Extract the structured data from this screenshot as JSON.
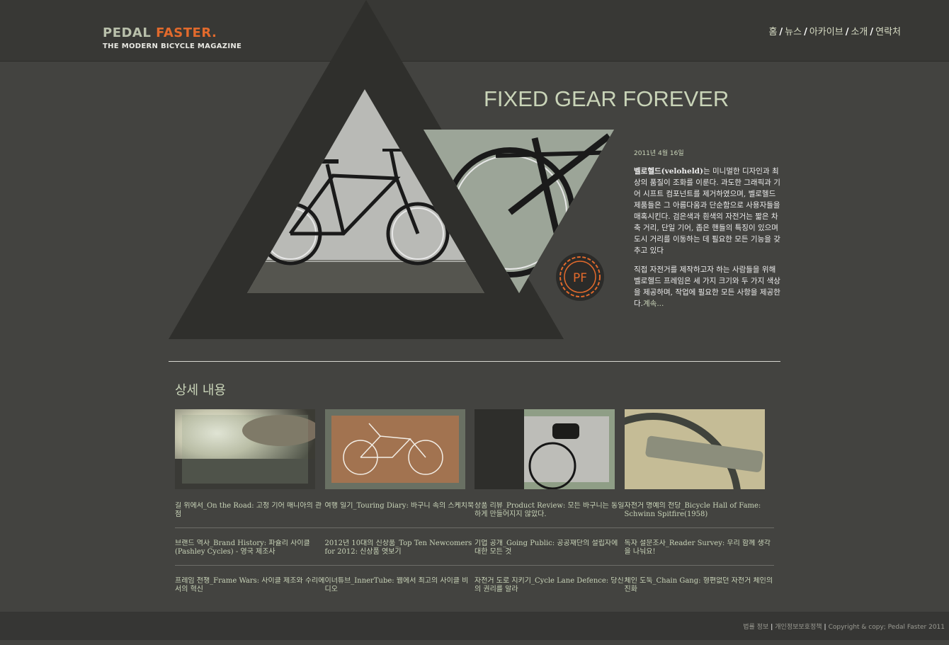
{
  "logo": {
    "name_part1": "PEDAL",
    "name_part2": "FASTER.",
    "tagline": "THE MODERN BICYCLE MAGAZINE"
  },
  "nav": {
    "items": [
      "홈",
      "뉴스",
      "아카이브",
      "소개",
      "연락처"
    ],
    "separator": "/"
  },
  "article": {
    "title": "FIXED GEAR FOREVER",
    "date": "2011년 4월 16일",
    "brand": "벨로헬드(veloheld)",
    "p1_rest": "는 미니멀한 디자인과 최상의 품질이 조화를 이룬다. 과도한 그래픽과 기어 시프트 컴포넌트를 제거하였으며, 벨로헬드 제품들은 그 아름다움과 단순함으로 사용자들을 매혹시킨다. 검은색과 흰색의 자전거는 짧은 차축 거리, 단일 기어, 좁은 핸들의 특징이 있으며 도시 거리를 이동하는 데 필요한 모든 기능을 갖추고 있다",
    "p2": "직접 자전거를 제작하고자 하는 사람들을 위해 벨로헬드 프레임은 세 가지 크기와 두 가지 색상을 제공하며, 작업에 필요한 모든 사항을 제공한다.",
    "more": "계속..."
  },
  "badge": {
    "text": "PF"
  },
  "section": {
    "title": "상세 내용"
  },
  "links": [
    [
      "길 위에서_On the Road: 고정 기어 매니아의 관점",
      "여행 일기_Touring Diary: 바구니 속의 스케치북",
      "상품 리뷰_Product Review: 모든 바구니는 동일하게 만들어지지 않았다.",
      "자전거 명예의 전당_Bicycle Hall of Fame: Schwinn Spitfire(1958)"
    ],
    [
      "브랜드 역사_Brand History: 파슐리 사이클(Pashley Cycles) - 영국 제조사",
      "2012년 10대의 신상품_Top Ten Newcomers for 2012: 신상품 엿보기",
      "기업 공개_Going Public: 공공재단의 설립자에 대한 모든 것",
      "독자 설문조사_Reader Survey: 우리 함께 생각을 나눠요!"
    ],
    [
      "프레임 전쟁_Frame Wars: 사이클 제조와 수리에서의 혁신",
      "이너튜브_InnerTube: 웹에서 최고의 사이클 비디오",
      "자전거 도로 지키기_Cycle Lane Defence: 당신의 권리를 알라",
      "체인 도둑_Chain Gang: 형편없던 자전거 체인의 진화"
    ]
  ],
  "footer": {
    "items": [
      "법률 정보",
      "개인정보보호정책",
      "Copyright & copy; Pedal Faster 2011"
    ]
  },
  "colors": {
    "accent": "#e26a2c",
    "sage": "#c9d4b8",
    "background": "#434340",
    "header": "#383835"
  }
}
